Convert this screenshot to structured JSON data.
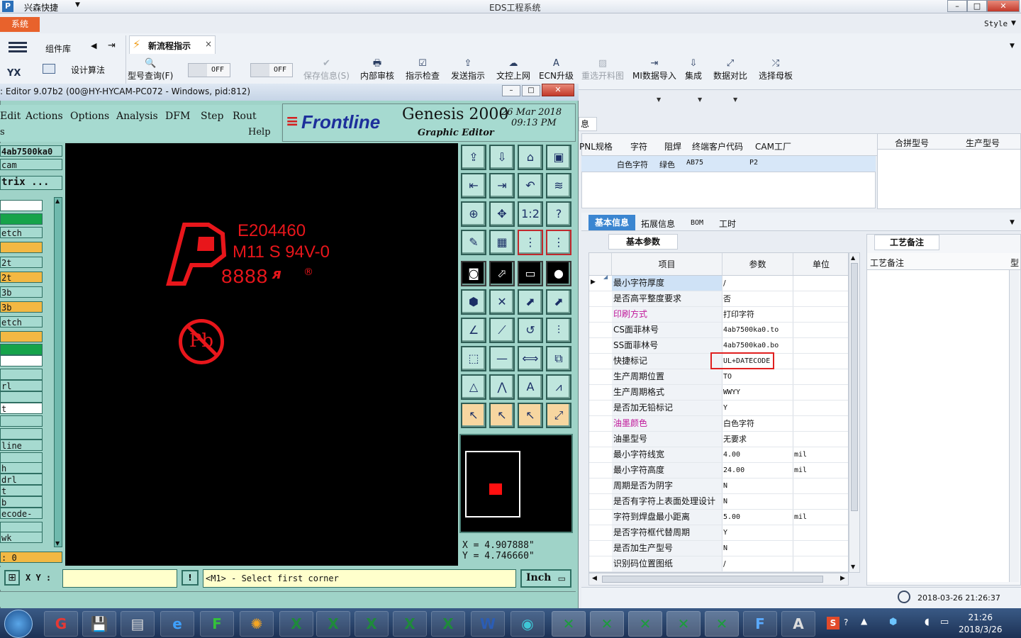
{
  "titlebar": {
    "app_name": "兴森快捷",
    "center_title": "EDS工程系统",
    "min": "–",
    "max": "□",
    "close": "✕"
  },
  "menu": {
    "system": "系统",
    "style": "Style"
  },
  "left_panel": {
    "component_lib": "组件库",
    "design_algo": "设计算法",
    "yx": "YX"
  },
  "tab": {
    "label": "新流程指示",
    "close": "×"
  },
  "toggles": [
    {
      "label": "OFF"
    },
    {
      "label": "OFF"
    }
  ],
  "toolbar": [
    {
      "label": "型号查询(F)",
      "icon": "🔍",
      "disabled": false
    },
    {
      "label": "保存信息(S)",
      "icon": "✔",
      "disabled": true
    },
    {
      "label": "内部审核",
      "icon": "🖶",
      "disabled": false
    },
    {
      "label": "指示检查",
      "icon": "☑",
      "disabled": false
    },
    {
      "label": "发送指示",
      "icon": "⇪",
      "disabled": false
    },
    {
      "label": "文控上网",
      "icon": "☁",
      "disabled": false
    },
    {
      "label": "ECN升级",
      "icon": "A",
      "disabled": false
    },
    {
      "label": "重选开料图",
      "icon": "▨",
      "disabled": true
    },
    {
      "label": "MI数据导入",
      "icon": "⇥",
      "disabled": false
    },
    {
      "label": "集成",
      "icon": "⇩",
      "disabled": false
    },
    {
      "label": "数据对比",
      "icon": "⤢",
      "disabled": false
    },
    {
      "label": "选择母板",
      "icon": "⤮",
      "disabled": false
    }
  ],
  "grid": {
    "headers": [
      "PNL规格",
      "字符",
      "阻焊",
      "终端客户代码",
      "CAM工厂"
    ],
    "row": [
      "白色字符",
      "绿色",
      "AB75",
      "P2"
    ],
    "right_headers": [
      "合拼型号",
      "生产型号"
    ],
    "partial": "息"
  },
  "detail_tabs": [
    "基本信息",
    "拓展信息",
    "BOM",
    "工时"
  ],
  "subtab": "基本参数",
  "note_tab": "工艺备注",
  "note_label": "工艺备注",
  "note_side": "型",
  "table": {
    "headers": [
      "项目",
      "参数",
      "单位"
    ],
    "rows": [
      {
        "item": "最小字符厚度",
        "value": "/",
        "unit": "",
        "hl": false,
        "mono": false
      },
      {
        "item": "是否高平整度要求",
        "value": "否",
        "unit": "",
        "hl": false,
        "mono": false
      },
      {
        "item": "印刷方式",
        "value": "打印字符",
        "unit": "",
        "hl": true,
        "mono": false
      },
      {
        "item": "CS面菲林号",
        "value": "4ab7500ka0.to",
        "unit": "",
        "hl": false,
        "mono": true
      },
      {
        "item": "SS面菲林号",
        "value": "4ab7500ka0.bo",
        "unit": "",
        "hl": false,
        "mono": true
      },
      {
        "item": "快捷标记",
        "value": "UL+DATECODE",
        "unit": "",
        "hl": false,
        "mono": true
      },
      {
        "item": "生产周期位置",
        "value": "TO",
        "unit": "",
        "hl": false,
        "mono": true
      },
      {
        "item": "生产周期格式",
        "value": "WWYY",
        "unit": "",
        "hl": false,
        "mono": true
      },
      {
        "item": "是否加无铅标记",
        "value": "Y",
        "unit": "",
        "hl": false,
        "mono": true
      },
      {
        "item": "油墨颜色",
        "value": "白色字符",
        "unit": "",
        "hl": true,
        "mono": false
      },
      {
        "item": "油墨型号",
        "value": "无要求",
        "unit": "",
        "hl": false,
        "mono": false
      },
      {
        "item": "最小字符线宽",
        "value": "4.00",
        "unit": "mil",
        "hl": false,
        "mono": true
      },
      {
        "item": "最小字符高度",
        "value": "24.00",
        "unit": "mil",
        "hl": false,
        "mono": true
      },
      {
        "item": "周期是否为阴字",
        "value": "N",
        "unit": "",
        "hl": false,
        "mono": true
      },
      {
        "item": "是否有字符上表面处理设计",
        "value": "N",
        "unit": "",
        "hl": false,
        "mono": true
      },
      {
        "item": "字符到焊盘最小距离",
        "value": "5.00",
        "unit": "mil",
        "hl": false,
        "mono": true
      },
      {
        "item": "是否字符框代替周期",
        "value": "Y",
        "unit": "",
        "hl": false,
        "mono": true
      },
      {
        "item": "是否加生产型号",
        "value": "N",
        "unit": "",
        "hl": false,
        "mono": true
      },
      {
        "item": "识别码位置图纸",
        "value": "/",
        "unit": "",
        "hl": false,
        "mono": false
      }
    ]
  },
  "status": {
    "datetime": "2018-03-26 21:26:37"
  },
  "genesis": {
    "title": ": Editor 9.07b2 (00@HY-HYCAM-PC072 - Windows, pid:812)",
    "menu": [
      "Edit",
      "Actions",
      "Options",
      "Analysis",
      "DFM",
      "Step",
      "Rout",
      "Help"
    ],
    "logo_brand": "Frontline",
    "logo_product": "Genesis 2000",
    "logo_sub": "Graphic Editor",
    "date": "26 Mar 2018",
    "time": "09:13 PM",
    "job": "4ab7500ka0",
    "step": "cam",
    "matrix": "trix ...",
    "layers": [
      "",
      "",
      "etch",
      "",
      "2t",
      "2t",
      "3b",
      "3b",
      "etch",
      "",
      "",
      "",
      "",
      "rl",
      "",
      "t",
      "",
      "",
      "line",
      "",
      "h",
      "drl",
      "t",
      "b",
      "ecode-pt",
      "",
      "wk"
    ],
    "counter": ": 0",
    "board_text": [
      "E204460",
      "M11 S 94V-0",
      "8888"
    ],
    "board_mark": "®",
    "coord_x": "X = 4.907888\"",
    "coord_y": "Y = 4.746660\"",
    "xy_label": "X Y :",
    "xy_value": "",
    "message": "<M1> - Select first corner",
    "unit": "Inch"
  },
  "clock": {
    "time": "21:26",
    "date": "2018/3/26"
  }
}
